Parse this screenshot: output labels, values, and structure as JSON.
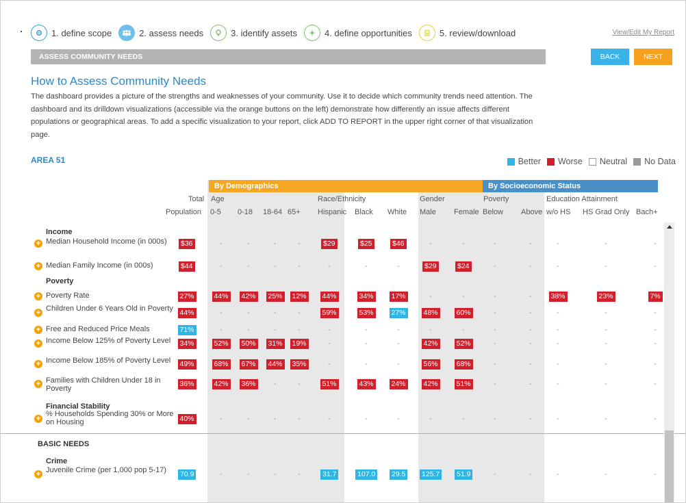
{
  "steps": [
    {
      "label": "1. define scope",
      "icon": "gear-icon"
    },
    {
      "label": "2. assess needs",
      "icon": "people-icon"
    },
    {
      "label": "3. identify assets",
      "icon": "lightbulb-icon"
    },
    {
      "label": "4. define opportunities",
      "icon": "compass-icon"
    },
    {
      "label": "5. review/download",
      "icon": "document-icon"
    }
  ],
  "view_edit": "View/Edit My Report",
  "section_bar": "ASSESS COMMUNITY NEEDS",
  "buttons": {
    "back": "BACK",
    "next": "NEXT"
  },
  "title": "How to Assess Community Needs",
  "intro": "The dashboard provides a picture of the strengths and weaknesses of your community. Use it to decide which community trends need attention. The dashboard and its drilldown visualizations (accessible via the orange buttons on the left) demonstrate how differently an issue affects different populations or geographical areas. To add a specific visualization to your report, click ADD TO REPORT in the upper right corner of that visualization page.",
  "area": "AREA 51",
  "legend": {
    "better": "Better",
    "worse": "Worse",
    "neutral": "Neutral",
    "nodata": "No Data"
  },
  "colors": {
    "better": "#30b4e4",
    "worse": "#d0202c",
    "demographics": "#f5a623",
    "socio": "#4a90c8"
  },
  "groups": {
    "demo": "By Demographics",
    "socio": "By Socioeconomic Status"
  },
  "headers": {
    "total1": "Total",
    "total2": "Population",
    "age": "Age",
    "race": "Race/Ethnicity",
    "gender": "Gender",
    "poverty": "Poverty",
    "edu": "Education Attainment",
    "c05": "0-5",
    "c018": "0-18",
    "c1864": "18-64",
    "c65": "65+",
    "hisp": "Hispanic",
    "black": "Black",
    "white": "White",
    "male": "Male",
    "female": "Female",
    "below": "Below",
    "above": "Above",
    "wohs": "w/o HS",
    "hsgrad": "HS Grad Only",
    "bach": "Bach+"
  },
  "sections": {
    "income": "Income",
    "poverty": "Poverty",
    "finstab": "Financial Stability",
    "basic": "BASIC NEEDS",
    "crime": "Crime"
  },
  "rows": [
    {
      "label": "Median Household Income (in 000s)",
      "cells": [
        "$36",
        "-",
        "-",
        "-",
        "-",
        "$29",
        "$25",
        "$46",
        "-",
        "-",
        "-",
        "-",
        "-",
        "-",
        "-"
      ],
      "status": [
        "w",
        "n",
        "n",
        "n",
        "n",
        "w",
        "w",
        "w",
        "n",
        "n",
        "n",
        "n",
        "n",
        "n",
        "n"
      ]
    },
    {
      "label": "Median Family Income (in 000s)",
      "cells": [
        "$44",
        "-",
        "-",
        "-",
        "-",
        "-",
        "-",
        "-",
        "$29",
        "$24",
        "-",
        "-",
        "-",
        "-",
        "-"
      ],
      "status": [
        "w",
        "n",
        "n",
        "n",
        "n",
        "n",
        "n",
        "n",
        "w",
        "w",
        "n",
        "n",
        "n",
        "n",
        "n"
      ]
    },
    {
      "label": "Poverty Rate",
      "cells": [
        "27%",
        "44%",
        "42%",
        "25%",
        "12%",
        "44%",
        "34%",
        "17%",
        "-",
        "-",
        "-",
        "-",
        "38%",
        "23%",
        "7%"
      ],
      "status": [
        "w",
        "w",
        "w",
        "w",
        "w",
        "w",
        "w",
        "w",
        "n",
        "n",
        "n",
        "n",
        "w",
        "w",
        "w"
      ]
    },
    {
      "label": "Children Under 6 Years Old in Poverty",
      "cells": [
        "44%",
        "-",
        "-",
        "-",
        "-",
        "59%",
        "53%",
        "27%",
        "48%",
        "60%",
        "-",
        "-",
        "-",
        "-",
        "-"
      ],
      "status": [
        "w",
        "n",
        "n",
        "n",
        "n",
        "w",
        "w",
        "b",
        "w",
        "w",
        "n",
        "n",
        "n",
        "n",
        "n"
      ]
    },
    {
      "label": "Free and Reduced Price Meals",
      "cells": [
        "71%",
        "-",
        "-",
        "-",
        "-",
        "-",
        "-",
        "-",
        "-",
        "-",
        "-",
        "-",
        "-",
        "-",
        "-"
      ],
      "status": [
        "b",
        "n",
        "n",
        "n",
        "n",
        "n",
        "n",
        "n",
        "n",
        "n",
        "n",
        "n",
        "n",
        "n",
        "n"
      ]
    },
    {
      "label": "Income Below 125% of Poverty Level",
      "cells": [
        "34%",
        "52%",
        "50%",
        "31%",
        "19%",
        "-",
        "-",
        "-",
        "42%",
        "52%",
        "-",
        "-",
        "-",
        "-",
        "-"
      ],
      "status": [
        "w",
        "w",
        "w",
        "w",
        "w",
        "n",
        "n",
        "n",
        "w",
        "w",
        "n",
        "n",
        "n",
        "n",
        "n"
      ]
    },
    {
      "label": "Income Below 185% of Poverty Level",
      "cells": [
        "49%",
        "68%",
        "67%",
        "44%",
        "35%",
        "-",
        "-",
        "-",
        "56%",
        "68%",
        "-",
        "-",
        "-",
        "-",
        "-"
      ],
      "status": [
        "w",
        "w",
        "w",
        "w",
        "w",
        "n",
        "n",
        "n",
        "w",
        "w",
        "n",
        "n",
        "n",
        "n",
        "n"
      ]
    },
    {
      "label": "Families with Children Under 18 in Poverty",
      "cells": [
        "36%",
        "42%",
        "36%",
        "-",
        "-",
        "51%",
        "43%",
        "24%",
        "42%",
        "51%",
        "-",
        "-",
        "-",
        "-",
        "-"
      ],
      "status": [
        "w",
        "w",
        "w",
        "n",
        "n",
        "w",
        "w",
        "w",
        "w",
        "w",
        "n",
        "n",
        "n",
        "n",
        "n"
      ]
    },
    {
      "label": "% Households Spending 30% or More on Housing",
      "cells": [
        "40%",
        "-",
        "-",
        "-",
        "-",
        "-",
        "-",
        "-",
        "-",
        "-",
        "-",
        "-",
        "-",
        "-",
        "-"
      ],
      "status": [
        "w",
        "n",
        "n",
        "n",
        "n",
        "n",
        "n",
        "n",
        "n",
        "n",
        "n",
        "n",
        "n",
        "n",
        "n"
      ]
    },
    {
      "label": "Juvenile Crime (per 1,000 pop 5-17)",
      "cells": [
        "70.9",
        "-",
        "-",
        "-",
        "-",
        "31.7",
        "107.0",
        "29.5",
        "125.7",
        "51.9",
        "-",
        "-",
        "-",
        "-",
        "-"
      ],
      "status": [
        "b",
        "n",
        "n",
        "n",
        "n",
        "b",
        "b",
        "b",
        "b",
        "b",
        "n",
        "n",
        "n",
        "n",
        "n"
      ]
    }
  ]
}
